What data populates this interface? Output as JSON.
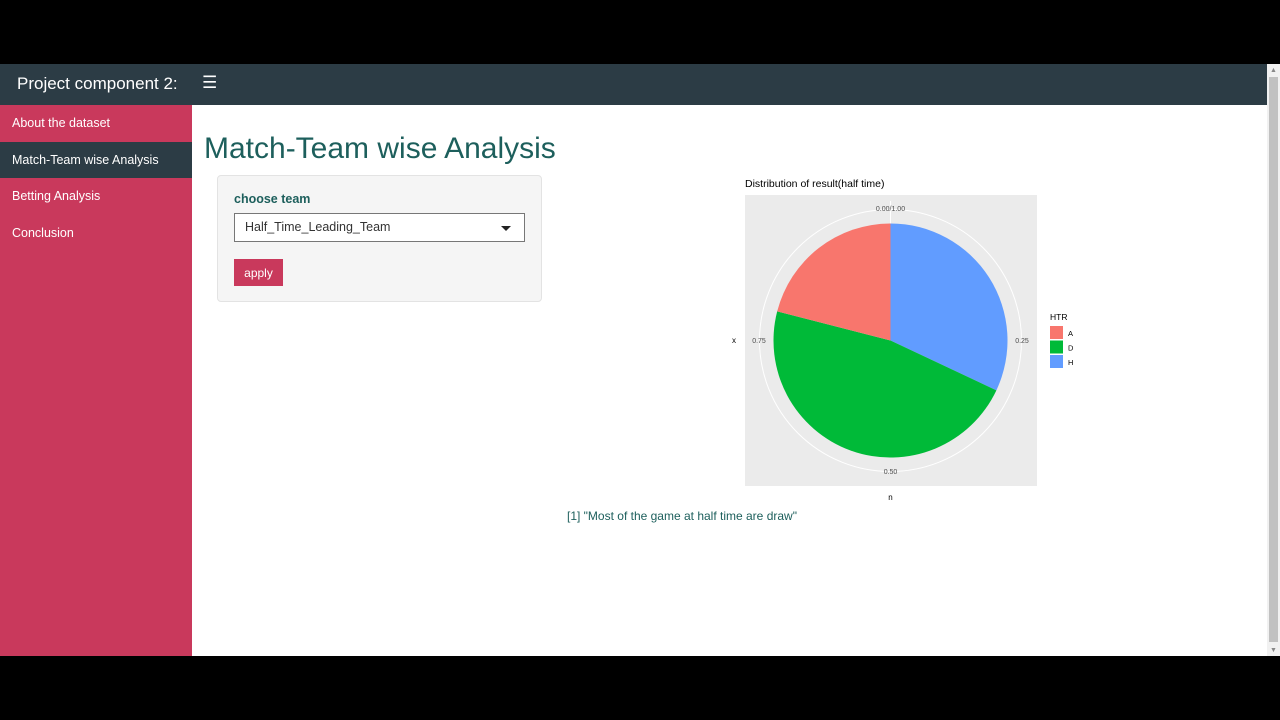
{
  "app": {
    "title": "Project component 2:",
    "menu_icon": "hamburger-icon"
  },
  "sidebar": {
    "items": [
      {
        "label": "About the dataset",
        "active": false
      },
      {
        "label": "Match-Team wise Analysis",
        "active": true
      },
      {
        "label": "Betting Analysis",
        "active": false
      },
      {
        "label": "Conclusion",
        "active": false
      }
    ]
  },
  "main": {
    "title": "Match-Team wise Analysis",
    "input_label": "choose team",
    "select_value": "Half_Time_Leading_Team",
    "apply_label": "apply",
    "summary": "[1] \"Most of the game at half time are draw\""
  },
  "chart_data": {
    "type": "pie",
    "title": "Distribution of result(half time)",
    "xlabel": "x",
    "ylabel": "n",
    "ticks": [
      "0.00/1.00",
      "0.25",
      "0.50",
      "0.75"
    ],
    "legend_title": "HTR",
    "legend_position": "right",
    "categories": [
      "A",
      "D",
      "H"
    ],
    "values": [
      0.21,
      0.47,
      0.32
    ],
    "colors": [
      "#f8766d",
      "#00ba38",
      "#619cff"
    ],
    "panel_background": "#ebebeb",
    "grid": true
  },
  "colors": {
    "accent": "#c9395c",
    "header": "#2c3c45",
    "title_text": "#1d5f5c"
  }
}
